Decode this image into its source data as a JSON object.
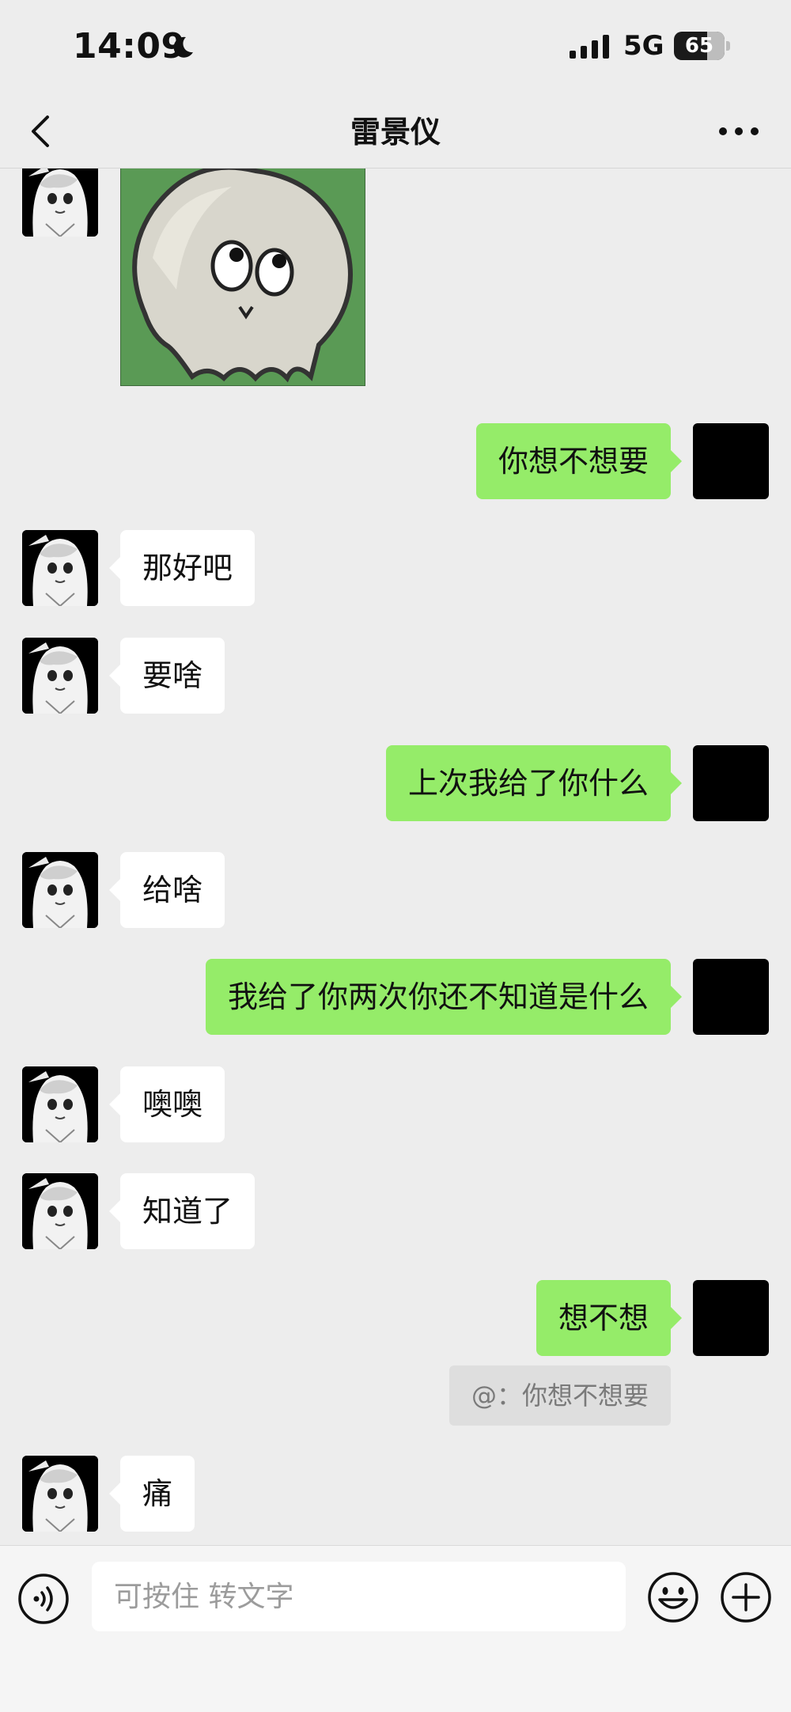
{
  "status_bar": {
    "time": "14:09",
    "network": "5G",
    "battery_percent": "65",
    "battery_level": 0.65
  },
  "nav": {
    "title": "雷景仪",
    "back_icon": "chevron-left-icon",
    "more_icon": "more-dots-icon"
  },
  "messages": [
    {
      "from": "contact",
      "type": "sticker",
      "content": "ghost-sticker"
    },
    {
      "from": "me",
      "type": "text",
      "text": "你想不想要"
    },
    {
      "from": "contact",
      "type": "text",
      "text": "那好吧"
    },
    {
      "from": "contact",
      "type": "text",
      "text": "要啥"
    },
    {
      "from": "me",
      "type": "text",
      "text": "上次我给了你什么"
    },
    {
      "from": "contact",
      "type": "text",
      "text": "给啥"
    },
    {
      "from": "me",
      "type": "text",
      "text": "我给了你两次你还不知道是什么"
    },
    {
      "from": "contact",
      "type": "text",
      "text": "噢噢"
    },
    {
      "from": "contact",
      "type": "text",
      "text": "知道了"
    },
    {
      "from": "me",
      "type": "text",
      "text": "想不想",
      "quote": "@：你想不想要"
    },
    {
      "from": "contact",
      "type": "text",
      "text": "痛"
    }
  ],
  "input_bar": {
    "placeholder": "可按住 转文字",
    "voice_icon": "voice-icon",
    "emoji_icon": "emoji-icon",
    "plus_icon": "plus-circle-icon"
  },
  "colors": {
    "background": "#ededed",
    "outgoing_bubble": "#95ec69",
    "incoming_bubble": "#ffffff",
    "sticker_bg": "#5a9a55"
  }
}
